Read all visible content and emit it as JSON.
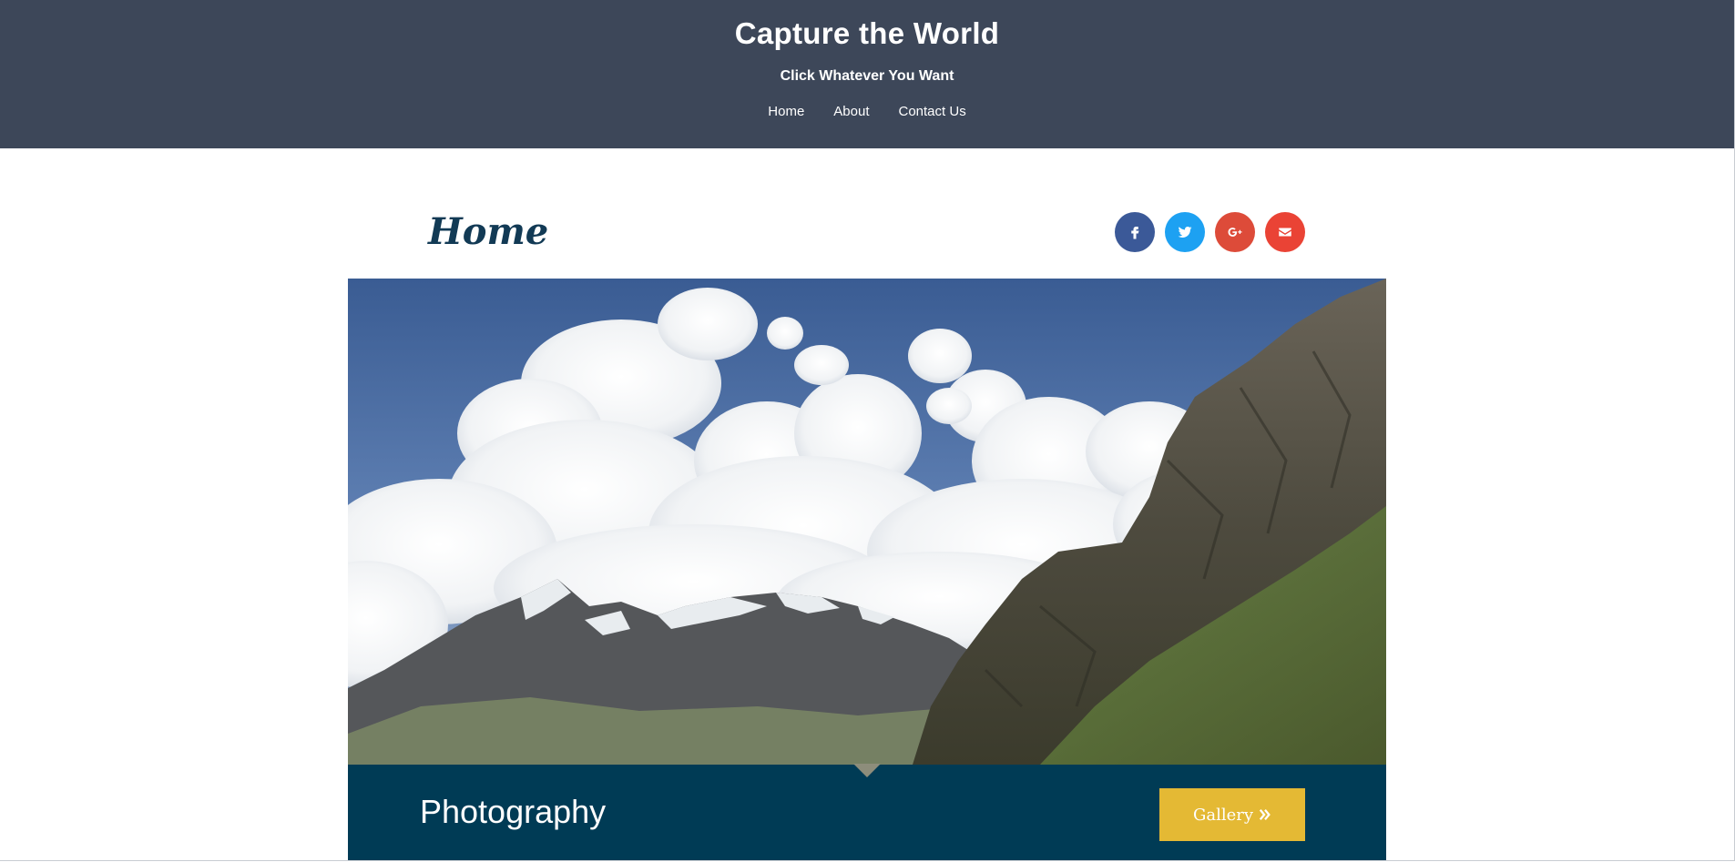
{
  "header": {
    "title": "Capture the World",
    "tagline": "Click Whatever You Want",
    "nav": [
      "Home",
      "About",
      "Contact Us"
    ]
  },
  "main": {
    "heading": "Home",
    "social": [
      {
        "name": "facebook",
        "icon": "facebook-icon",
        "color": "#3b5998"
      },
      {
        "name": "twitter",
        "icon": "twitter-icon",
        "color": "#1da1f2"
      },
      {
        "name": "google-plus",
        "icon": "google-plus-icon",
        "color": "#dd4b39"
      },
      {
        "name": "email",
        "icon": "envelope-icon",
        "color": "#ea4335"
      }
    ],
    "hero": {
      "subject": "mountains-clouds-photo"
    },
    "caption": {
      "title": "Photography",
      "button_label": "Gallery",
      "button_icon": "double-chevron-right-icon"
    }
  },
  "colors": {
    "header_bg": "#3d4759",
    "caption_bg": "#003b55",
    "button_bg": "#e4b934",
    "heading_color": "#123a55"
  }
}
